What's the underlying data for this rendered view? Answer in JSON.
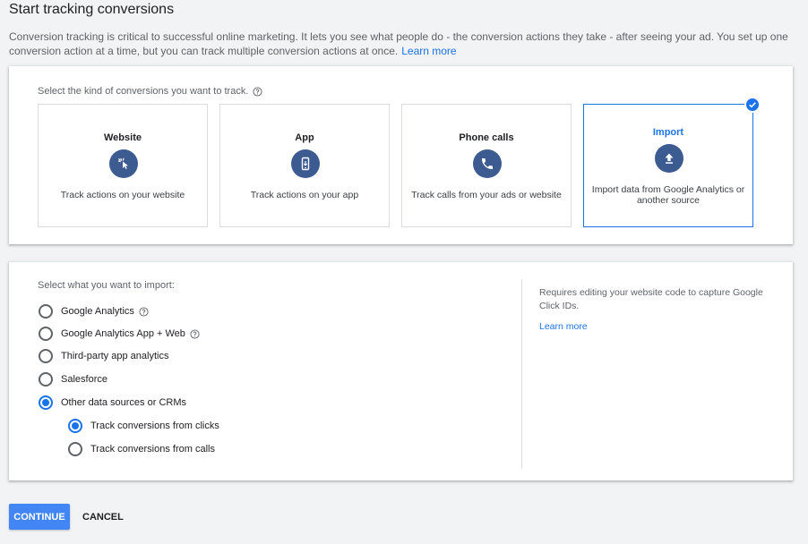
{
  "header": {
    "title": "Start tracking conversions",
    "intro": "Conversion tracking is critical to successful online marketing. It lets you see what people do - the conversion actions they take - after seeing your ad. You set up one conversion action at a time, but you can track multiple conversion actions at once.",
    "learn_more": "Learn more"
  },
  "kind": {
    "prompt": "Select the kind of conversions you want to track.",
    "options": [
      {
        "title": "Website",
        "icon": "cursor-click-icon",
        "desc": "Track actions on your website",
        "selected": false
      },
      {
        "title": "App",
        "icon": "smartphone-icon",
        "desc": "Track actions on your app",
        "selected": false
      },
      {
        "title": "Phone calls",
        "icon": "phone-icon",
        "desc": "Track calls from your ads or website",
        "selected": false
      },
      {
        "title": "Import",
        "icon": "upload-icon",
        "desc": "Import data from Google Analytics or another source",
        "selected": true
      }
    ]
  },
  "import": {
    "prompt": "Select what you want to import:",
    "options": [
      {
        "label": "Google Analytics",
        "checked": false,
        "help": true
      },
      {
        "label": "Google Analytics App + Web",
        "checked": false,
        "help": true
      },
      {
        "label": "Third-party app analytics",
        "checked": false,
        "help": false
      },
      {
        "label": "Salesforce",
        "checked": false,
        "help": false
      },
      {
        "label": "Other data sources or CRMs",
        "checked": true,
        "help": false
      }
    ],
    "sub_options": [
      {
        "label": "Track conversions from clicks",
        "checked": true
      },
      {
        "label": "Track conversions from calls",
        "checked": false
      }
    ],
    "note": "Requires editing your website code to capture Google Click IDs.",
    "note_link": "Learn more"
  },
  "actions": {
    "continue_label": "CONTINUE",
    "cancel_label": "CANCEL"
  },
  "colors": {
    "accent": "#1a73e8",
    "icon_bg": "#3c5b91",
    "primary_button": "#4285f4"
  }
}
